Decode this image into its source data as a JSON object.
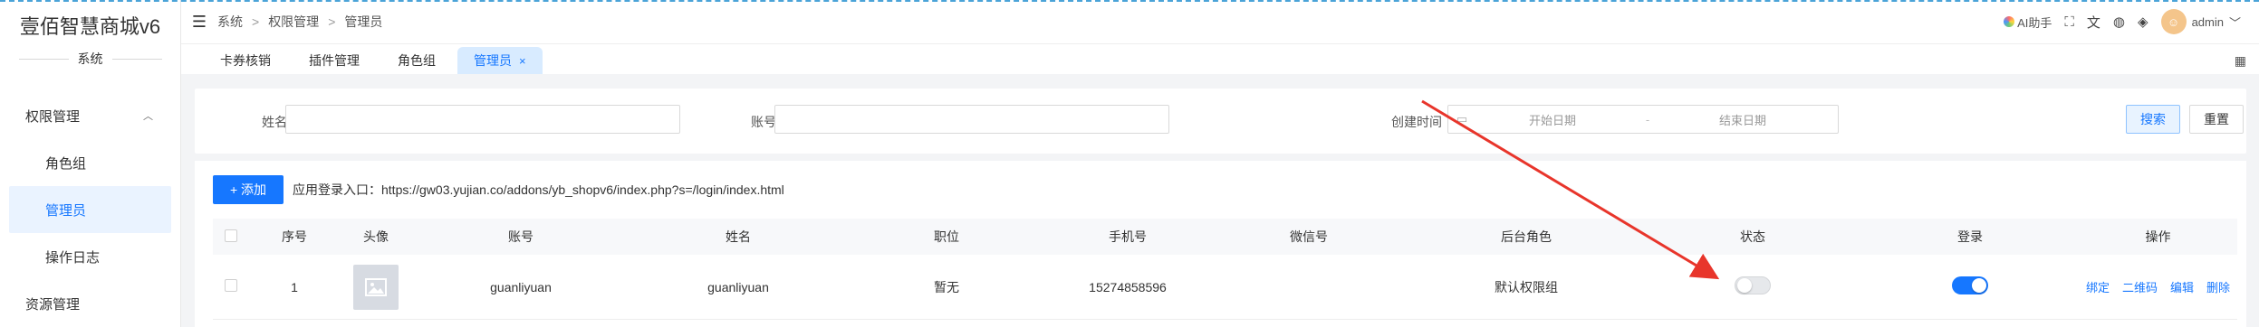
{
  "brand": "壹佰智慧商城v6",
  "sidebar": {
    "group_title": "系统",
    "items": [
      {
        "label": "权限管理",
        "chevron": "chevron-up-icon"
      },
      {
        "label": "角色组"
      },
      {
        "label": "管理员"
      },
      {
        "label": "操作日志"
      },
      {
        "label": "资源管理"
      }
    ]
  },
  "header": {
    "menu_icon": "hamburger-icon",
    "breadcrumb": [
      "系统",
      "权限管理",
      "管理员"
    ],
    "breadcrumb_sep": ">",
    "ai_label": "AI助手",
    "user": "admin"
  },
  "tabs": [
    {
      "label": "卡券核销"
    },
    {
      "label": "插件管理"
    },
    {
      "label": "角色组"
    },
    {
      "label": "管理员",
      "close": "×"
    }
  ],
  "search": {
    "name_label": "姓名",
    "account_label": "账号",
    "created_label": "创建时间",
    "start_placeholder": "开始日期",
    "date_sep": "-",
    "end_placeholder": "结束日期",
    "search_btn": "搜索",
    "reset_btn": "重置"
  },
  "toolbar": {
    "add_label": "+ 添加",
    "entry_text": "应用登录入口：https://gw03.yujian.co/addons/yb_shopv6/index.php?s=/login/index.html"
  },
  "table": {
    "columns": [
      "序号",
      "头像",
      "账号",
      "姓名",
      "职位",
      "手机号",
      "微信号",
      "后台角色",
      "状态",
      "登录",
      "操作"
    ],
    "rows": [
      {
        "index": "1",
        "account": "guanliyuan",
        "name": "guanliyuan",
        "position": "暂无",
        "phone": "15274858596",
        "wechat": "",
        "role": "默认权限组",
        "status_on": false,
        "login_on": true,
        "ops": [
          "绑定",
          "二维码",
          "编辑",
          "删除"
        ]
      }
    ]
  },
  "colors": {
    "accent": "#1677ff",
    "annotation_arrow": "#e8352b"
  }
}
